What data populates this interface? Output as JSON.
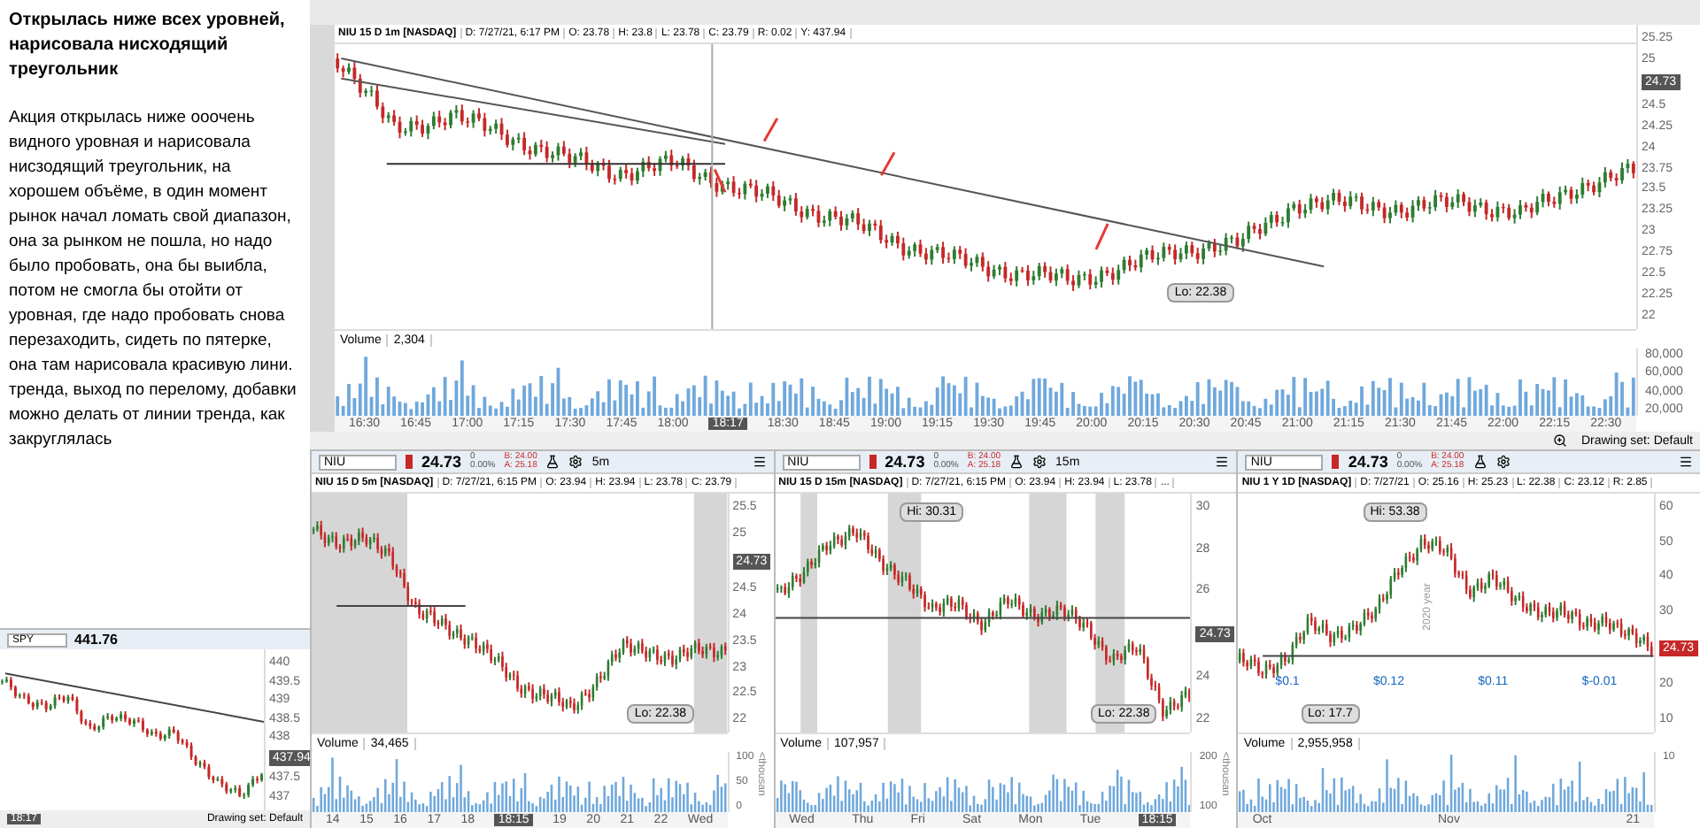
{
  "note": {
    "title": "Открылась ниже всех уровней, нарисовала нисходящий треугольник",
    "body": "Акция открылась ниже ооочень видного уровная и нарисовала нисзодящий треугольник, на хорошем объёме, в один момент рынок начал ломать свой диапазон, она за рынком не пошла, но надо было пробовать, она бы выибла, потом не смогла бы отойти от уровная, где надо пробовать снова перезаходить, сидеть по пятерке, она там нарисовала красивую лини. тренда, выход по перелому, добавки можно делать от линии тренда, как закруглялась"
  },
  "spy": {
    "symbol": "SPY",
    "price": "441.76",
    "yticks": [
      "440",
      "439.5",
      "439",
      "438.5",
      "438",
      "437.5",
      "437"
    ],
    "last_price": "437.94",
    "cursor_time": "18:17",
    "drawing_set": "Drawing set: Default"
  },
  "main": {
    "header": [
      "NIU 15 D 1m [NASDAQ]",
      "D: 7/27/21, 6:17 PM",
      "O: 23.78",
      "H: 23.8",
      "L: 23.78",
      "C: 23.79",
      "R: 0.02",
      "Y: 437.94"
    ],
    "yticks": [
      "25.25",
      "25",
      "24.5",
      "24.25",
      "24",
      "23.75",
      "23.5",
      "23.25",
      "23",
      "22.75",
      "22.5",
      "22.25",
      "22"
    ],
    "last_price": "24.73",
    "lo_label": "Lo: 22.38",
    "volume_label": "Volume",
    "volume_value": "2,304",
    "volume_ticks": [
      "80,000",
      "60,000",
      "40,000",
      "20,000"
    ],
    "xticks": [
      "16:30",
      "16:45",
      "17:00",
      "17:15",
      "17:30",
      "17:45",
      "18:00",
      "18:17",
      "18:30",
      "18:45",
      "19:00",
      "19:15",
      "19:30",
      "19:45",
      "20:00",
      "20:15",
      "20:30",
      "20:45",
      "21:00",
      "21:15",
      "21:30",
      "21:45",
      "22:00",
      "22:15",
      "22:30"
    ],
    "drawing_set": "Drawing set: Default"
  },
  "panels": [
    {
      "symbol": "NIU",
      "price": "24.73",
      "change": "0",
      "percent": "0.00%",
      "bid": "B: 24.00",
      "ask": "A: 25.18",
      "interval": "5m",
      "header": [
        "NIU 15 D 5m [NASDAQ]",
        "D: 7/27/21, 6:15 PM",
        "O: 23.94",
        "H: 23.94",
        "L: 23.78",
        "C: 23.79"
      ],
      "yticks": [
        "25.5",
        "25",
        "24.5",
        "24",
        "23.5",
        "23",
        "22.5",
        "22"
      ],
      "last_price": "24.73",
      "lo_label": "Lo: 22.38",
      "volume_label": "Volume",
      "volume_value": "34,465",
      "volume_ticks": [
        "100",
        "50",
        "0"
      ],
      "volume_unit": "<thousan",
      "xticks": [
        "14",
        "15",
        "16",
        "17",
        "18",
        "18:15",
        "19",
        "20",
        "21",
        "22",
        "Wed"
      ]
    },
    {
      "symbol": "NIU",
      "price": "24.73",
      "change": "0",
      "percent": "0.00%",
      "bid": "B: 24.00",
      "ask": "A: 25.18",
      "interval": "15m",
      "header": [
        "NIU 15 D 15m [NASDAQ]",
        "D: 7/27/21, 6:15 PM",
        "O: 23.94",
        "H: 23.94",
        "L: 23.78",
        "..."
      ],
      "yticks": [
        "30",
        "28",
        "26",
        "24",
        "22"
      ],
      "last_price": "24.73",
      "hi_label": "Hi: 30.31",
      "lo_label": "Lo: 22.38",
      "volume_label": "Volume",
      "volume_value": "107,957",
      "volume_ticks": [
        "200",
        "100"
      ],
      "volume_unit": "<thousan",
      "xticks": [
        "Wed",
        "Thu",
        "Fri",
        "Sat",
        "Mon",
        "Tue",
        "18:15"
      ]
    },
    {
      "symbol": "NIU",
      "price": "24.73",
      "change": "0",
      "percent": "0.00%",
      "bid": "B: 24.00",
      "ask": "A: 25.18",
      "header": [
        "NIU 1 Y 1D [NASDAQ]",
        "D: 7/27/21",
        "O: 25.16",
        "H: 25.23",
        "L: 22.38",
        "C: 23.12",
        "R: 2.85"
      ],
      "yticks": [
        "60",
        "50",
        "40",
        "30",
        "20",
        "10"
      ],
      "last_price": "24.73",
      "hi_label": "Hi: 53.38",
      "lo_label": "Lo: 17.7",
      "volume_label": "Volume",
      "volume_value": "2,955,958",
      "volume_ticks": [
        "10"
      ],
      "year_label": "2020 year",
      "events": [
        "$0.1",
        "$0.12",
        "$0.11",
        "$-0.01"
      ],
      "xticks": [
        "Oct",
        "Nov",
        "21"
      ]
    }
  ]
}
